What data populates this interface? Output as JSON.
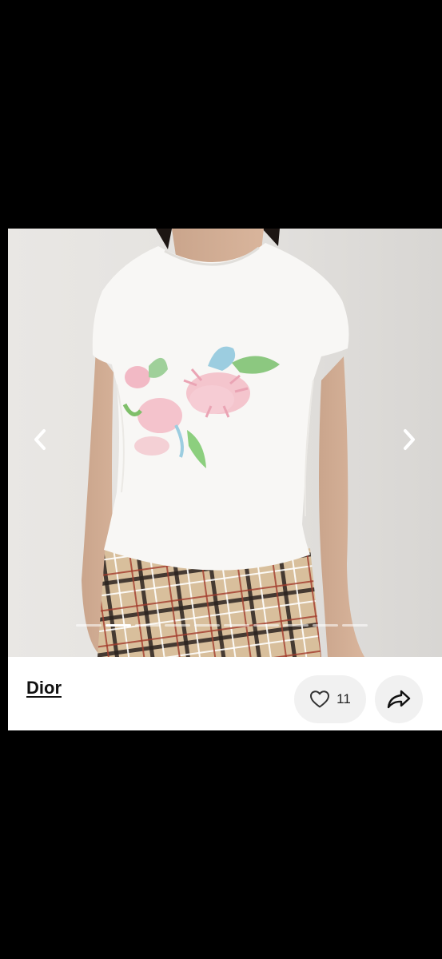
{
  "product": {
    "brand": "Dior",
    "like_count": "11"
  },
  "gallery": {
    "image_count": 10,
    "active_index": 1
  },
  "icons": {
    "prev": "chevron-left-icon",
    "next": "chevron-right-icon",
    "like": "heart-outline-icon",
    "share": "share-arrow-icon"
  },
  "colors": {
    "background": "#000000",
    "card": "#ffffff",
    "pill": "#f1f1f1",
    "text": "#111111"
  }
}
